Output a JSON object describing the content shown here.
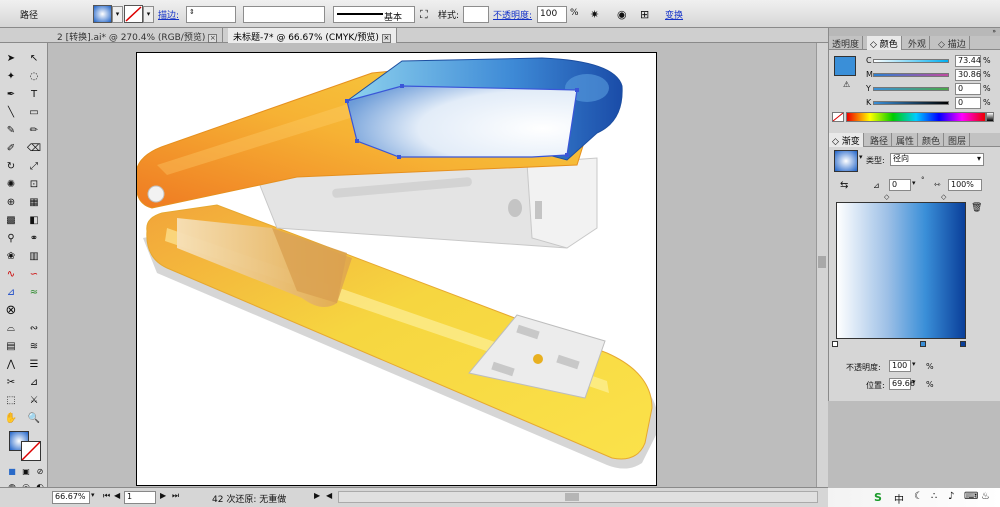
{
  "control": {
    "mode_label": "路径",
    "stroke_label": "描边:",
    "brush_label": "基本",
    "style_label": "样式:",
    "opacity_label": "不透明度:",
    "opacity_value": "100",
    "opacity_unit": "%",
    "transform_label": "变换"
  },
  "tabs": [
    {
      "label": "2 [转换].ai* @ 270.4% (RGB/预览)"
    },
    {
      "label": "未标题-7* @ 66.67% (CMYK/预览)"
    }
  ],
  "color_panel": {
    "tabs": [
      "透明度",
      "颜色",
      "外观",
      "描边"
    ],
    "channels": [
      {
        "name": "C",
        "value": "73.44"
      },
      {
        "name": "M",
        "value": "30.86"
      },
      {
        "name": "Y",
        "value": "0"
      },
      {
        "name": "K",
        "value": "0"
      }
    ],
    "fill_color": "#3a8fd8"
  },
  "gradient_panel": {
    "tabs": [
      "渐变",
      "路径",
      "属性",
      "颜色",
      "图层"
    ],
    "type_label": "类型:",
    "type_value": "径向",
    "angle_value": "0",
    "aspect_value": "100",
    "aspect_unit": "%",
    "opacity_label": "不透明度:",
    "opacity_value": "100",
    "opacity_unit": "%",
    "location_label": "位置:",
    "location_value": "69.66",
    "location_unit": "%",
    "start_color": "#ffffff",
    "end_color": "#0a3f9a"
  },
  "status": {
    "zoom": "66.67%",
    "page": "1",
    "history": "42 次还原: 无重做"
  },
  "tray": {
    "icons": [
      "input-method-icon",
      "moon-icon",
      "dots-icon",
      "microphone-icon",
      "keyboard-icon",
      "shirt-icon",
      "grid-icon"
    ]
  }
}
